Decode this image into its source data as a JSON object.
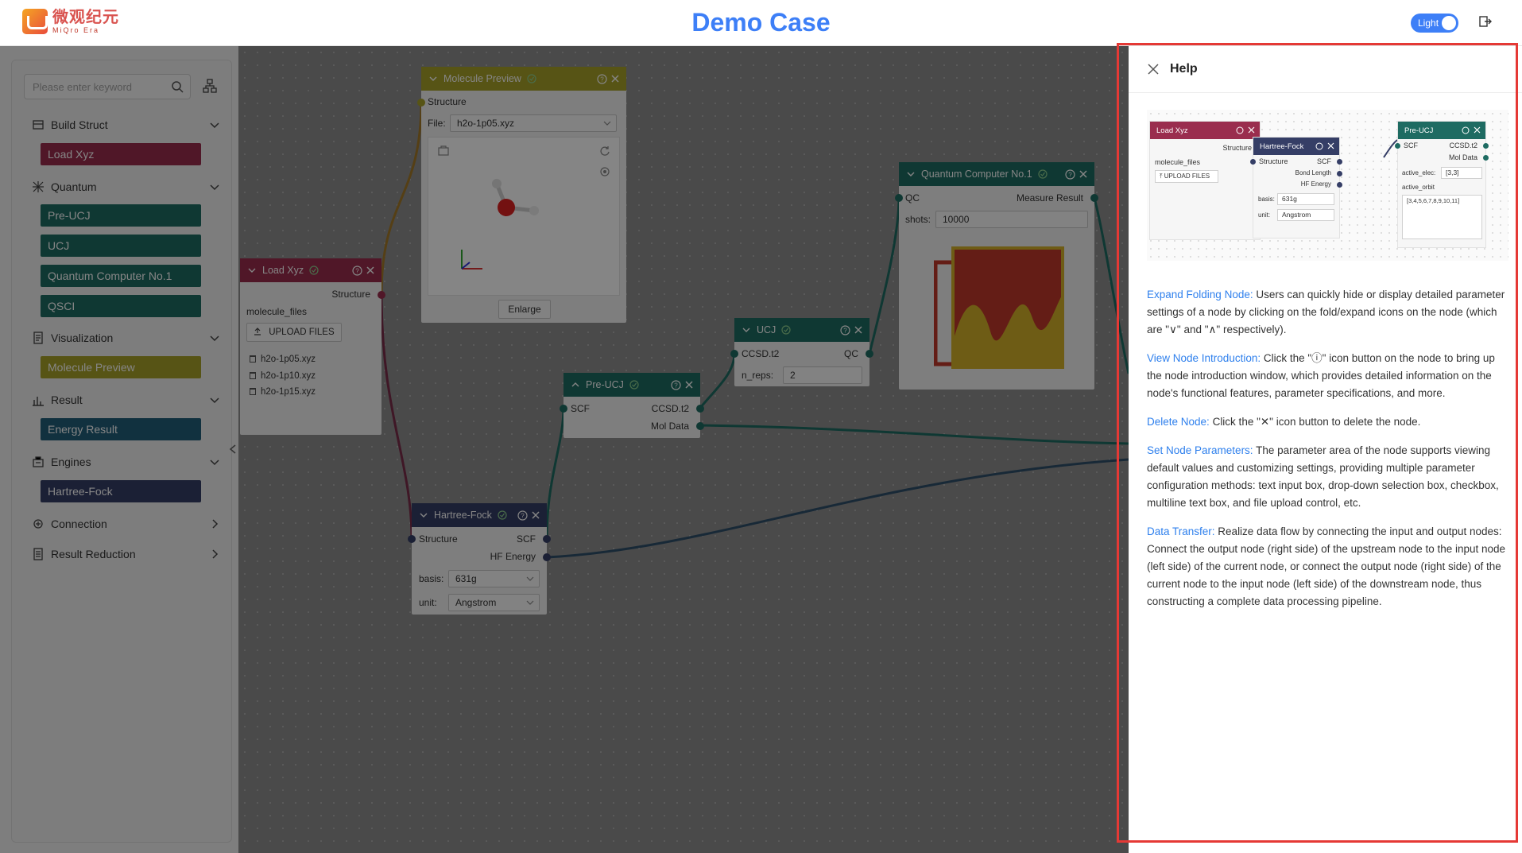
{
  "app": {
    "logo_cn": "微观纪元",
    "logo_en": "MiQro Era",
    "title": "Demo Case",
    "theme_label": "Light"
  },
  "sidebar": {
    "search_placeholder": "Please enter keyword",
    "categories": [
      {
        "label": "Build Struct",
        "items": [
          {
            "label": "Load Xyz"
          }
        ]
      },
      {
        "label": "Quantum",
        "items": [
          {
            "label": "Pre-UCJ"
          },
          {
            "label": "UCJ"
          },
          {
            "label": "Quantum Computer No.1"
          },
          {
            "label": "QSCI"
          }
        ]
      },
      {
        "label": "Visualization",
        "items": [
          {
            "label": "Molecule Preview"
          }
        ]
      },
      {
        "label": "Result",
        "items": [
          {
            "label": "Energy Result"
          }
        ]
      },
      {
        "label": "Engines",
        "items": [
          {
            "label": "Hartree-Fock"
          }
        ]
      },
      {
        "label": "Connection",
        "items": []
      },
      {
        "label": "Result Reduction",
        "items": []
      }
    ]
  },
  "canvas": {
    "molecule_preview": {
      "title": "Molecule Preview",
      "input": "Structure",
      "file_label": "File:",
      "file_value": "h2o-1p05.xyz",
      "enlarge_label": "Enlarge"
    },
    "load_xyz": {
      "title": "Load Xyz",
      "output": "Structure",
      "field_label": "molecule_files",
      "upload_label": "UPLOAD FILES",
      "files": [
        "h2o-1p05.xyz",
        "h2o-1p10.xyz",
        "h2o-1p15.xyz"
      ]
    },
    "quantum_computer": {
      "title": "Quantum Computer No.1",
      "input": "QC",
      "output": "Measure Result",
      "shots_label": "shots:",
      "shots_value": "10000"
    },
    "ucj": {
      "title": "UCJ",
      "input": "CCSD.t2",
      "output": "QC",
      "nreps_label": "n_reps:",
      "nreps_value": "2"
    },
    "pre_ucj": {
      "title": "Pre-UCJ",
      "input": "SCF",
      "outputs": [
        "CCSD.t2",
        "Mol Data"
      ]
    },
    "hartree_fock": {
      "title": "Hartree-Fock",
      "input": "Structure",
      "outputs": [
        "SCF",
        "HF Energy"
      ],
      "basis_label": "basis:",
      "basis_value": "631g",
      "unit_label": "unit:",
      "unit_value": "Angstrom"
    }
  },
  "help": {
    "title": "Help",
    "preview": {
      "load_xyz": {
        "title": "Load Xyz",
        "output": "Structure",
        "field_label": "molecule_files",
        "upload_label": "UPLOAD FILES"
      },
      "hartree_fock": {
        "title": "Hartree-Fock",
        "input": "Structure",
        "outputs": [
          "SCF",
          "Bond Length",
          "HF Energy"
        ],
        "basis_label": "basis:",
        "basis_value": "631g",
        "unit_label": "unit:",
        "unit_value": "Angstrom"
      },
      "pre_ucj": {
        "title": "Pre-UCJ",
        "input": "SCF",
        "outputs": [
          "CCSD.t2",
          "Mol Data"
        ],
        "active_elec_label": "active_elec:",
        "active_elec_value": "[3,3]",
        "active_orbit_label": "active_orbit",
        "active_orbit_value": "[3,4,5,6,7,8,9,10,11]"
      }
    },
    "sections": [
      {
        "keyword": "Expand Folding Node:",
        "text": " Users can quickly hide or display detailed parameter settings of a node by clicking on the fold/expand icons on the node (which are \"∨\" and \"∧\" respectively)."
      },
      {
        "keyword": "View Node Introduction:",
        "text": " Click the \"ⓘ\" icon button on the node to bring up the node introduction window, which provides detailed information on the node's functional features, parameter specifications, and more."
      },
      {
        "keyword": "Delete Node:",
        "text": " Click the \"✕\" icon button to delete the node."
      },
      {
        "keyword": "Set Node Parameters:",
        "text": " The parameter area of the node supports viewing default values and customizing settings, providing multiple parameter configuration methods: text input box, drop-down selection box, checkbox, multiline text box, and file upload control, etc."
      },
      {
        "keyword": "Data Transfer:",
        "text": " Realize data flow by connecting the input and output nodes: Connect the output node (right side) of the upstream node to the input node (left side) of the current node, or connect the output node (right side) of the current node to the input node (left side) of the downstream node, thus constructing a complete data processing pipeline."
      }
    ]
  },
  "colors": {
    "accent": "#3d7ff7",
    "build_struct": "#9a2d4e",
    "quantum": "#1e6b62",
    "visualization": "#a8a22a",
    "result": "#225f7a",
    "engines": "#353e66",
    "highlight": "#e53935"
  },
  "icons": {
    "search": "search-icon",
    "tree": "tree-icon",
    "close": "close-icon",
    "help": "question-circle-icon",
    "fold": "chevron-down-icon",
    "check": "check-circle-icon",
    "exit": "exit-icon"
  }
}
